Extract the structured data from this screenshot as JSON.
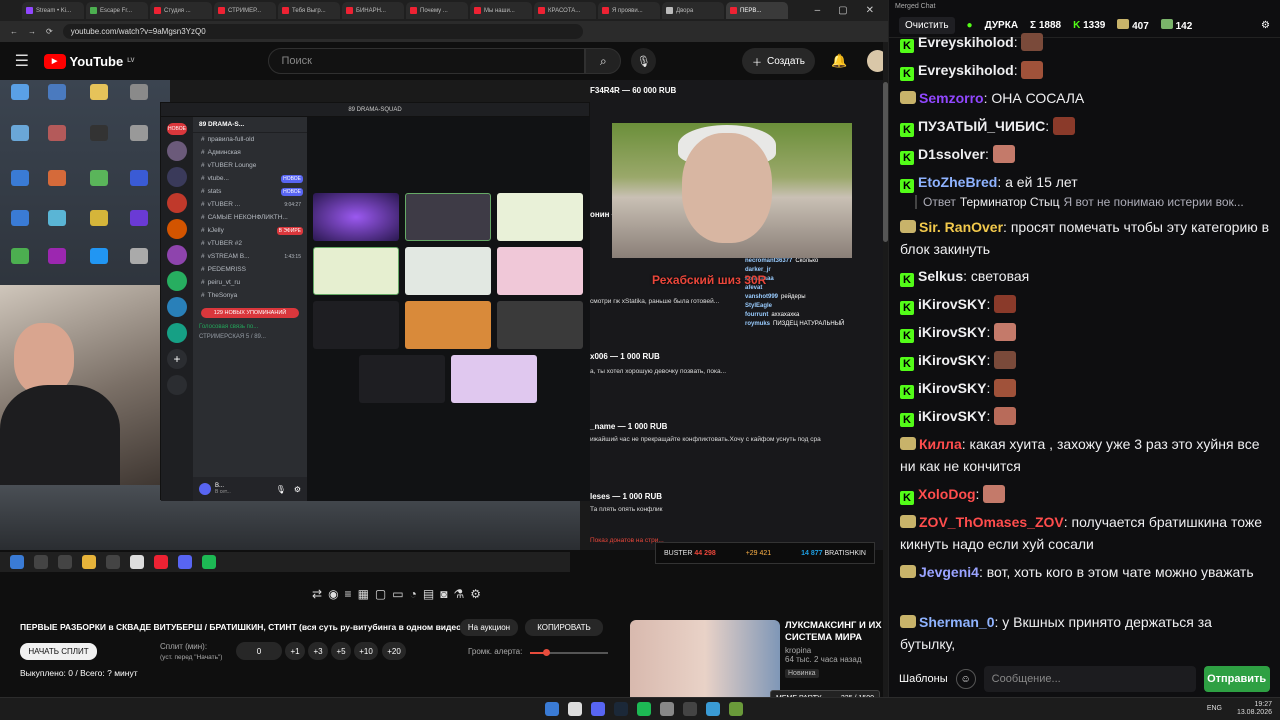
{
  "browser": {
    "tabs": [
      {
        "label": "Stream • Ki...",
        "active": false
      },
      {
        "label": "Escape Fr...",
        "active": false
      },
      {
        "label": "Студия ...",
        "active": false
      },
      {
        "label": "СТРИМЕР...",
        "active": false
      },
      {
        "label": "Тебя Выгр...",
        "active": false
      },
      {
        "label": "БИНАРН...",
        "active": false
      },
      {
        "label": "Почему ...",
        "active": false
      },
      {
        "label": "Мы наши...",
        "active": false
      },
      {
        "label": "КРАСОТА...",
        "active": false
      },
      {
        "label": "Я прояви...",
        "active": false
      },
      {
        "label": "Двора",
        "active": false
      },
      {
        "label": "ПЕРВ...",
        "active": true
      }
    ],
    "url": "youtube.com/watch?v=9aMgsn3YzQ0"
  },
  "youtube": {
    "logo": "YouTube",
    "region": "LV",
    "search_placeholder": "Поиск",
    "create_label": "Создать"
  },
  "discord": {
    "window_title": "89 DRAMA-SQUAD",
    "server_name": "89 DRAMA-S...",
    "new_label": "НОВОЕ",
    "channels": [
      {
        "label": "правила-full-old",
        "badge": ""
      },
      {
        "label": "Админская",
        "badge": ""
      },
      {
        "label": "vTUBER Lounge",
        "badge": ""
      },
      {
        "label": "vtube...",
        "badge": "НОВОЕ"
      },
      {
        "label": "stats",
        "badge": "НОВОЕ"
      },
      {
        "label": "vTUBER ...",
        "badge": "9:04:27"
      },
      {
        "label": "САМЫЕ НЕКОНФЛИКТН...",
        "badge": ""
      },
      {
        "label": "kJelly",
        "badge": "В ЭФИРЕ"
      },
      {
        "label": "vTUBER #2",
        "badge": ""
      },
      {
        "label": "vSTREAM B...",
        "badge": "1:43:15"
      },
      {
        "label": "PEDEMRISS",
        "badge": ""
      },
      {
        "label": "peiru_vt_ru",
        "badge": ""
      },
      {
        "label": "TheSonya",
        "badge": ""
      }
    ],
    "mentions": "129 НОВЫХ УПОМИНАНИЙ",
    "voice_status": "Голосовая связь по...",
    "voice_sub": "СТРИМЕРСКАЯ 5 / 89...",
    "user_name": "В...",
    "user_status": "В сет..."
  },
  "stream": {
    "donations": [
      {
        "name": "F34R4R — 60 000 RUB",
        "text": ""
      },
      {
        "name": "онин — 1 000 RUB",
        "text": "смотри гж xStatika, раньше была готовей..."
      },
      {
        "name": "x006 — 1 000 RUB",
        "text": "а, ты хотел хорошую девочку позвать, пока..."
      },
      {
        "name": "_name — 1 000 RUB",
        "text": "ижайший час не прекращайте конфликтовать.Хочу с кайфом уснуть под сра"
      },
      {
        "name": "leses — 1 000 RUB",
        "text": "Та плять опять конфлик"
      }
    ],
    "overlay_caption": "Рехабский шиз 30R",
    "chat_lines": [
      {
        "user": "necromant36377",
        "text": "Сколько"
      },
      {
        "user": "darker_jr",
        "text": ""
      },
      {
        "user": "kolaaaaaa",
        "text": ""
      },
      {
        "user": "afevat",
        "text": ""
      },
      {
        "user": "vanshot999",
        "text": "рейдеры"
      },
      {
        "user": "StylEagle",
        "text": ""
      },
      {
        "user": "fourrunt",
        "text": "аххахахка"
      },
      {
        "user": "roymuks",
        "text": "ПИЗДЕЦ НАТУРАЛЬНЫЙ"
      }
    ],
    "donbar_left": "BUSTER",
    "donbar_left_amount": "44 298",
    "donbar_right_amount": "14 877",
    "donbar_right": "BRATISHKIN",
    "donbar_delta": "+29 421",
    "donations_footer": "Показ донатов на стри..."
  },
  "below": {
    "title": "ПЕРВЫЕ РАЗБОРКИ в СКВАДЕ ВИТУБЕРШ / БРАТИШКИН, СТИНТ (вся суть ру-витубинга в одном видео)",
    "auction_label": "На аукцион",
    "copy_label": "КОПИРОВАТЬ",
    "start_split_label": "НАЧАТЬ СПЛИТ",
    "split_label": "Сплит (мин):",
    "split_hint": "(уст. перед \"Начать\")",
    "split_value": "0",
    "steps": [
      "+1",
      "+3",
      "+5",
      "+10",
      "+20"
    ],
    "volume_label": "Громк. алерта:",
    "volume_fraction": 0.22,
    "bought": "Выкуплено: 0 / Всего: ? минут",
    "rec_title": "ЛУКСМАКСИНГ И ИХ СИСТЕМА МИРА",
    "rec_channel": "kropina",
    "rec_meta": "64 тыс. 2 часа назад",
    "rec_badge": "Новинка"
  },
  "meme_party": {
    "label": "MEME PARTY",
    "value": "225 / 1500"
  },
  "taskbar": {
    "lang": "ENG",
    "time": "19:27",
    "date": "13.08.2026"
  },
  "merged_chat": {
    "window_title": "Merged Chat",
    "clear_label": "Очистить",
    "header_name": "ДУРКА",
    "sigma": "Σ 1888",
    "kick_count": "1339",
    "twitch_count": "407",
    "viewers": "142",
    "messages": [
      {
        "platform": "kick",
        "user": "Evreyskiholod",
        "color": "#efeff1",
        "text": "",
        "emote": true
      },
      {
        "platform": "kick",
        "user": "Evreyskiholod",
        "color": "#efeff1",
        "text": "",
        "emote": true
      },
      {
        "platform": "twitch",
        "user": "Semzorro",
        "color": "#9147ff",
        "text": "ОНА СОСАЛА",
        "emote": false
      },
      {
        "platform": "kick",
        "user": "ПУЗАТЫЙ_ЧИБИС",
        "color": "#efeff1",
        "text": "",
        "emote": true
      },
      {
        "platform": "kick",
        "user": "D1ssolver",
        "color": "#efeff1",
        "text": "",
        "emote": true
      },
      {
        "platform": "kick",
        "user": "EtoZheBred",
        "color": "#8fb3ff",
        "text": "а ей 15 лет",
        "emote": false
      },
      {
        "platform": "twitch",
        "user": "Sir. RanOver",
        "color": "#f2c94c",
        "text": "просят помечать чтобы эту категорию в блок закинуть",
        "emote": false
      },
      {
        "platform": "kick",
        "user": "Selkus",
        "color": "#efeff1",
        "text": "световая",
        "emote": false
      },
      {
        "platform": "kick",
        "user": "iKirovSKY",
        "color": "#efeff1",
        "text": "",
        "emote": true
      },
      {
        "platform": "kick",
        "user": "iKirovSKY",
        "color": "#efeff1",
        "text": "",
        "emote": true
      },
      {
        "platform": "kick",
        "user": "iKirovSKY",
        "color": "#efeff1",
        "text": "",
        "emote": true
      },
      {
        "platform": "kick",
        "user": "iKirovSKY",
        "color": "#efeff1",
        "text": "",
        "emote": true
      },
      {
        "platform": "kick",
        "user": "iKirovSKY",
        "color": "#efeff1",
        "text": "",
        "emote": true
      },
      {
        "platform": "twitch",
        "user": "Килла",
        "color": "#ff4d4d",
        "text": "какая хуита , захожу уже 3 раз это хуйня все ни как не кончится",
        "emote": false
      },
      {
        "platform": "kick",
        "user": "XoloDog",
        "color": "#ff4d4d",
        "text": "",
        "emote": true
      },
      {
        "platform": "twitch",
        "user": "ZOV_ThOmases_ZOV",
        "color": "#ff4d4d",
        "text": "получается братишкина тоже кикнуть надо если хуй сосали",
        "emote": false
      },
      {
        "platform": "twitch",
        "user": "Jevgeni4",
        "color": "#9aa3ff",
        "text": "вот, хоть кого в этом чате можно уважать",
        "emote": false
      },
      {
        "platform": "twitch",
        "user": "Sherman_0",
        "color": "#8fb3ff",
        "text": "у Вкшных принято держаться за бутылку,",
        "emote": false
      }
    ],
    "reply": {
      "prefix": "Ответ",
      "user": "Терминатор Стыц",
      "text": "Я вот не понимаю истерии вок..."
    },
    "templates_label": "Шаблоны",
    "input_placeholder": "Сообщение...",
    "send_label": "Отправить"
  }
}
